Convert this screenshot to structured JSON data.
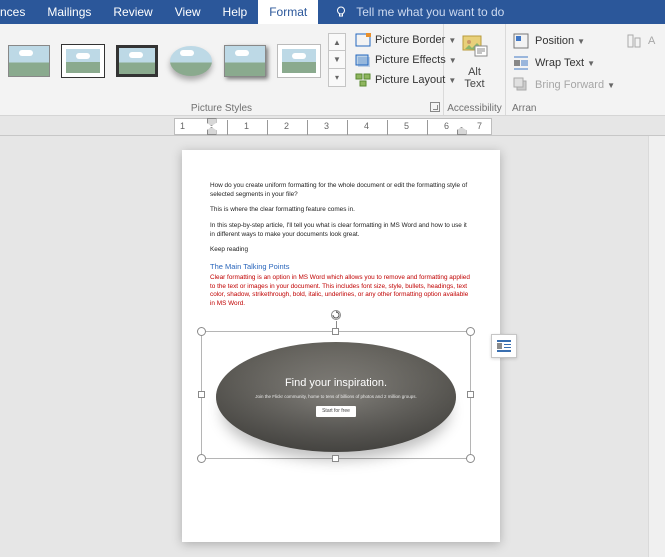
{
  "tabs": [
    "nces",
    "Mailings",
    "Review",
    "View",
    "Help",
    "Format"
  ],
  "active_tab": 5,
  "tellme": "Tell me what you want to do",
  "picture_menu": {
    "border": "Picture Border",
    "effects": "Picture Effects",
    "layout": "Picture Layout"
  },
  "group_labels": {
    "styles": "Picture Styles",
    "accessibility": "Accessibility",
    "arrange": "Arran"
  },
  "alt_text": "Alt\nText",
  "arrange": {
    "position": "Position",
    "wrap": "Wrap Text",
    "forward": "Bring Forward",
    "align_stub": "A"
  },
  "document": {
    "p1": "How do you create uniform formatting for the whole document or edit the formatting style of selected segments in your file?",
    "p2": "This is where the clear formatting feature comes in.",
    "p3": "In this step-by-step article, I'll tell you what is clear formatting in MS Word and how to use it in different ways to make your documents look great.",
    "p4": "Keep reading",
    "heading": "The Main Talking Points",
    "red": "Clear formatting is an option in MS Word which allows you to remove and formatting applied to the text or images in your document. This includes font size, style, bullets, headings, text color, shadow, strikethrough, bold, italic, underlines, or any other formatting option available in MS Word.",
    "pic_title": "Find your inspiration.",
    "pic_sub": "Join the Flickr community, home to tens of billions of photos and 2 million groups.",
    "pic_btn": "Start for free"
  },
  "ruler_numbers": [
    "1",
    "1",
    "2",
    "3",
    "4",
    "5",
    "6",
    "7"
  ]
}
